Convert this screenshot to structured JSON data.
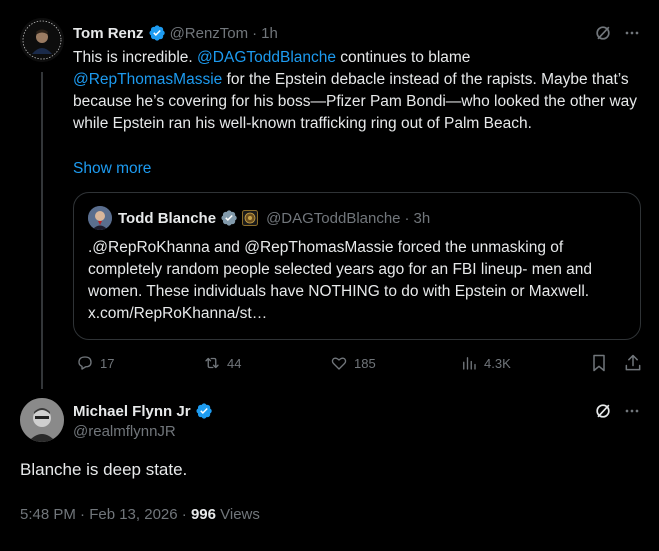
{
  "tweet1": {
    "author_name": "Tom Renz",
    "handle": "@RenzTom",
    "sep": "·",
    "time": "1h",
    "avatar_text": "TOM RENZ",
    "text_1": "This is incredible. ",
    "mention_1": "@DAGToddBlanche",
    "text_2": " continues to blame",
    "mention_2": "@RepThomasMassie",
    "text_3": " for the Epstein debacle instead of the rapists. Maybe that’s because he’s covering for his boss—Pfizer Pam Bondi—who looked the other way while Epstein ran his well-known trafficking ring out of Palm Beach.",
    "show_more": "Show more",
    "quote": {
      "author_name": "Todd Blanche",
      "handle": "@DAGToddBlanche",
      "sep": "·",
      "time": "3h",
      "text": ".@RepRoKhanna and @RepThomasMassie forced the unmasking of completely random people selected years ago for an FBI lineup- men and women. These individuals have NOTHING to do with Epstein or Maxwell. x.com/RepRoKhanna/st…"
    },
    "actions": {
      "replies": "17",
      "reposts": "44",
      "likes": "185",
      "views": "4.3K"
    }
  },
  "tweet2": {
    "author_name": "Michael Flynn Jr",
    "handle": "@realmflynnJR",
    "text": "Blanche is deep state.",
    "timestamp": "5:48 PM · Feb 13, 2026 · ",
    "views_count": "996",
    "views_label": " Views"
  },
  "colors": {
    "background": "#000000",
    "text": "#e7e9ea",
    "muted": "#71767b",
    "link": "#1d9bf0",
    "border": "#2f3336",
    "verified": "#1d9bf0"
  }
}
